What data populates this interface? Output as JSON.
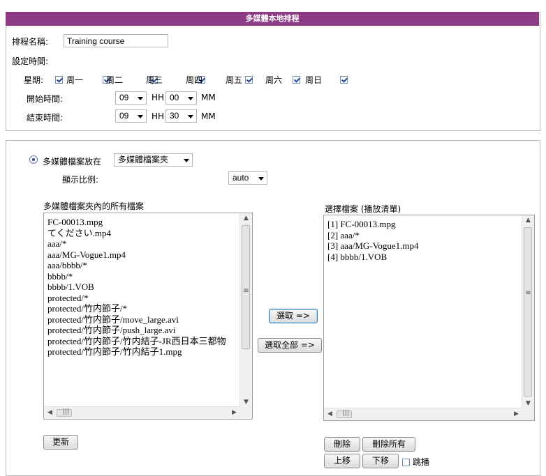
{
  "header": {
    "title": "多媒體本地排程"
  },
  "schedule": {
    "name_label": "排程名稱:",
    "name_value": "Training course",
    "time_settings_label": "設定時間:",
    "week_label": "星期:",
    "days": [
      {
        "label": "周一",
        "checked": true
      },
      {
        "label": "周二",
        "checked": true
      },
      {
        "label": "周三",
        "checked": true
      },
      {
        "label": "周四",
        "checked": true
      },
      {
        "label": "周五",
        "checked": true
      },
      {
        "label": "周六",
        "checked": true
      },
      {
        "label": "周日",
        "checked": true
      }
    ],
    "start_label": "開始時間:",
    "start_hour": "09",
    "start_minute": "00",
    "end_label": "結束時間:",
    "end_hour": "09",
    "end_minute": "30",
    "hh_label": "HH",
    "mm_label": "MM"
  },
  "media": {
    "source_label": "多媒體檔案放在",
    "source_value": "多媒體檔案夾",
    "ratio_label": "顯示比例:",
    "ratio_value": "auto",
    "all_files_label": "多媒體檔案夾內的所有檔案",
    "all_files": [
      "FC-00013.mpg",
      "てください.mp4",
      "aaa/*",
      "aaa/MG-Vogue1.mp4",
      "aaa/bbbb/*",
      "bbbb/*",
      "bbbb/1.VOB",
      "protected/*",
      "protected/竹内節子/*",
      "protected/竹内節子/move_large.avi",
      "protected/竹内節子/push_large.avi",
      "protected/竹内節子/竹内結子-JR西日本三都物",
      "protected/竹内節子/竹内結子1.mpg"
    ],
    "selected_label": "選擇檔案 (播放清單)",
    "selected_files": [
      "[1] FC-00013.mpg",
      "[2] aaa/*",
      "[3] aaa/MG-Vogue1.mp4",
      "[4] bbbb/1.VOB"
    ],
    "select_button": "選取 =>",
    "select_all_button": "選取全部 =>",
    "refresh_button": "更新",
    "delete_button": "刪除",
    "delete_all_button": "刪除所有",
    "move_up_button": "上移",
    "move_down_button": "下移",
    "skip_label": "跳播"
  }
}
